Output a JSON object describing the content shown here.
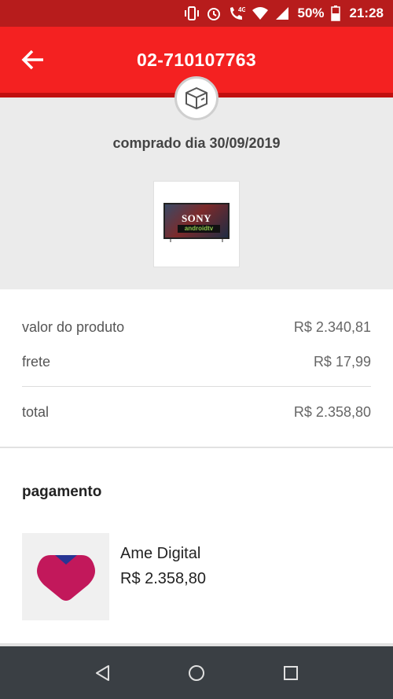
{
  "status_bar": {
    "network": "4G",
    "battery": "50%",
    "time": "21:28",
    "icons": [
      "vibrate-icon",
      "alarm-icon",
      "wifi-call-icon",
      "wifi-icon",
      "signal-icon",
      "battery-icon"
    ]
  },
  "header": {
    "order_id": "02-710107763",
    "back_icon": "arrow-left-icon"
  },
  "order": {
    "purchased_label": "comprado dia 30/09/2019",
    "box_icon": "package-icon",
    "product": {
      "brand": "SONY",
      "platform": "androidtv"
    }
  },
  "summary": {
    "rows": [
      {
        "label": "valor do produto",
        "value": "R$ 2.340,81"
      },
      {
        "label": "frete",
        "value": "R$ 17,99"
      }
    ],
    "total": {
      "label": "total",
      "value": "R$ 2.358,80"
    }
  },
  "payment": {
    "title": "pagamento",
    "method": "Ame Digital",
    "amount": "R$ 2.358,80",
    "logo_icon": "ame-logo-icon"
  },
  "navigation": {
    "buttons": [
      "back-triangle-icon",
      "home-circle-icon",
      "recents-square-icon"
    ]
  },
  "colors": {
    "status_bar": "#b71c1c",
    "app_bar": "#f42121",
    "nav_bar": "#3a3f44",
    "ame_logo": "#c2185b"
  }
}
